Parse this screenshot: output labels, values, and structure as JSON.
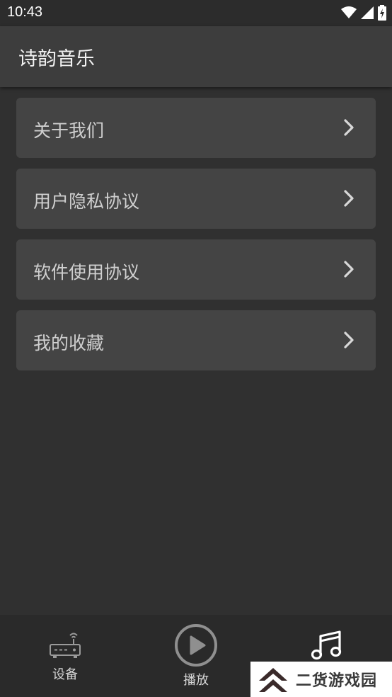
{
  "status_bar": {
    "time": "10:43",
    "icons": [
      "wifi-icon",
      "signal-icon",
      "battery-charging-icon"
    ]
  },
  "app_bar": {
    "title": "诗韵音乐"
  },
  "menu": {
    "items": [
      {
        "label": "关于我们",
        "icon": "chevron-right-icon"
      },
      {
        "label": "用户隐私协议",
        "icon": "chevron-right-icon"
      },
      {
        "label": "软件使用协议",
        "icon": "chevron-right-icon"
      },
      {
        "label": "我的收藏",
        "icon": "chevron-right-icon"
      }
    ]
  },
  "bottom_nav": {
    "items": [
      {
        "label": "设备",
        "icon": "router-icon"
      },
      {
        "label": "播放",
        "icon": "play-circle-icon"
      },
      {
        "label": "",
        "icon": "music-note-icon",
        "active": true
      }
    ]
  },
  "watermark": {
    "text": "二货游戏园"
  },
  "colors": {
    "background": "#303030",
    "app_bar": "#3d3d3d",
    "card": "#444444",
    "bottom_nav": "#2a2a2a"
  }
}
